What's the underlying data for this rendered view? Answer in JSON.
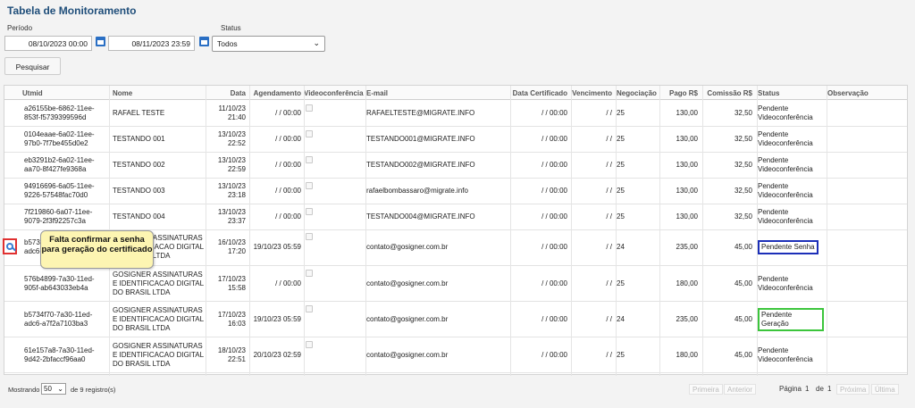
{
  "title": "Tabela de Monitoramento",
  "filters": {
    "periodo_label": "Período",
    "status_label": "Status",
    "date_from": "08/10/2023 00:00",
    "date_to": "08/11/2023 23:59",
    "status_value": "Todos",
    "search_button": "Pesquisar"
  },
  "columns": [
    "Utmid",
    "Nome",
    "Data",
    "Agendamento",
    "Videoconferência",
    "E-mail",
    "Data Certificado",
    "Vencimento",
    "Negociação",
    "Pago R$",
    "Comissão R$",
    "Status",
    "Observação"
  ],
  "rows": [
    {
      "utmid": "a26155be-6862-11ee-853f-f5739399596d",
      "nome": "RAFAEL TESTE",
      "data": "11/10/23 21:40",
      "agend": "/ / 00:00",
      "email": "RAFAELTESTE@MIGRATE.INFO",
      "datacert": "/ / 00:00",
      "venc": "/ /",
      "neg": "25",
      "pago": "130,00",
      "com": "32,50",
      "status": "Pendente Videoconferência"
    },
    {
      "utmid": "0104eaae-6a02-11ee-97b0-7f7be455d0e2",
      "nome": "TESTANDO 001",
      "data": "13/10/23 22:52",
      "agend": "/ / 00:00",
      "email": "TESTANDO001@MIGRATE.INFO",
      "datacert": "/ / 00:00",
      "venc": "/ /",
      "neg": "25",
      "pago": "130,00",
      "com": "32,50",
      "status": "Pendente Videoconferência"
    },
    {
      "utmid": "eb3291b2-6a02-11ee-aa70-8f427fe9368a",
      "nome": "TESTANDO 002",
      "data": "13/10/23 22:59",
      "agend": "/ / 00:00",
      "email": "TESTANDO002@MIGRATE.INFO",
      "datacert": "/ / 00:00",
      "venc": "/ /",
      "neg": "25",
      "pago": "130,00",
      "com": "32,50",
      "status": "Pendente Videoconferência"
    },
    {
      "utmid": "94916696-6a05-11ee-9226-57548fac70d0",
      "nome": "TESTANDO 003",
      "data": "13/10/23 23:18",
      "agend": "/ / 00:00",
      "email": "rafaelbombassaro@migrate.info",
      "datacert": "/ / 00:00",
      "venc": "/ /",
      "neg": "25",
      "pago": "130,00",
      "com": "32,50",
      "status": "Pendente Videoconferência"
    },
    {
      "utmid": "7f219860-6a07-11ee-9079-2f3f92257c3a",
      "nome": "TESTANDO 004",
      "data": "13/10/23 23:37",
      "agend": "/ / 00:00",
      "email": "TESTANDO004@MIGRATE.INFO",
      "datacert": "/ / 00:00",
      "venc": "/ /",
      "neg": "25",
      "pago": "130,00",
      "com": "32,50",
      "status": "Pendente Videoconferência"
    },
    {
      "utmid": "b5734f70-7a30-11ed-adc6-a7f2a7103ba3",
      "nome": "GOSIGNER ASSINATURAS E IDENTIFICACAO DIGITAL DO BRASIL LTDA",
      "data": "16/10/23 17:20",
      "agend": "19/10/23 05:59",
      "email": "contato@gosigner.com.br",
      "datacert": "/ / 00:00",
      "venc": "/ /",
      "neg": "24",
      "pago": "235,00",
      "com": "45,00",
      "status": "Pendente Senha"
    },
    {
      "utmid": "576b4899-7a30-11ed-905f-ab643033eb4a",
      "nome": "GOSIGNER ASSINATURAS E IDENTIFICACAO DIGITAL DO BRASIL LTDA",
      "data": "17/10/23 15:58",
      "agend": "/ / 00:00",
      "email": "contato@gosigner.com.br",
      "datacert": "/ / 00:00",
      "venc": "/ /",
      "neg": "25",
      "pago": "180,00",
      "com": "45,00",
      "status": "Pendente Videoconferência"
    },
    {
      "utmid": "b5734f70-7a30-11ed-adc6-a7f2a7103ba3",
      "nome": "GOSIGNER ASSINATURAS E IDENTIFICACAO DIGITAL DO BRASIL LTDA",
      "data": "17/10/23 16:03",
      "agend": "19/10/23 05:59",
      "email": "contato@gosigner.com.br",
      "datacert": "/ / 00:00",
      "venc": "/ /",
      "neg": "24",
      "pago": "235,00",
      "com": "45,00",
      "status": "Pendente Geração"
    },
    {
      "utmid": "61e157a8-7a30-11ed-9d42-2bfaccf96aa0",
      "nome": "GOSIGNER ASSINATURAS E IDENTIFICACAO DIGITAL DO BRASIL LTDA",
      "data": "18/10/23 22:51",
      "agend": "20/10/23 02:59",
      "email": "contato@gosigner.com.br",
      "datacert": "/ / 00:00",
      "venc": "/ /",
      "neg": "25",
      "pago": "180,00",
      "com": "45,00",
      "status": "Pendente Videoconferência"
    }
  ],
  "tooltip": "Falta confirmar a senha para geração do certificado",
  "highlight_colors": {
    "blue": "#1c2fb8",
    "green": "#3cc53c",
    "red": "#e03030"
  },
  "footer": {
    "mostrando": "Mostrando",
    "per_page": "50",
    "registros": "de 9 registro(s)",
    "primeira": "Primeira",
    "anterior": "Anterior",
    "pagina": "Página",
    "page": "1",
    "de": "de",
    "total": "1",
    "proxima": "Próxima",
    "ultima": "Última"
  }
}
